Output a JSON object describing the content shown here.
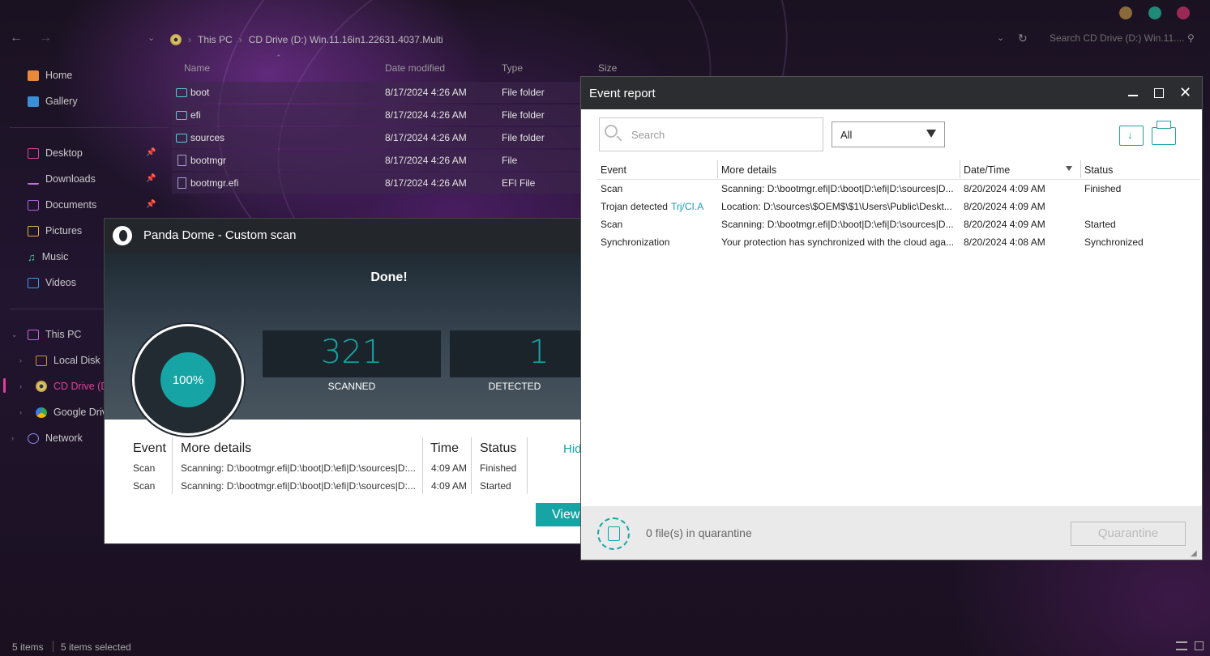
{
  "explorer": {
    "address": [
      "This PC",
      "CD Drive (D:) Win.11.16in1.22631.4037.Multi"
    ],
    "search_placeholder": "Search CD Drive (D:) Win.11....",
    "sidebar": {
      "home": "Home",
      "gallery": "Gallery",
      "desktop": "Desktop",
      "downloads": "Downloads",
      "documents": "Documents",
      "pictures": "Pictures",
      "music": "Music",
      "videos": "Videos",
      "this_pc": "This PC",
      "local_disk": "Local Disk (C:",
      "cd_drive": "CD Drive (D:",
      "google_drive": "Google Drive",
      "network": "Network"
    },
    "columns": [
      "Name",
      "Date modified",
      "Type",
      "Size"
    ],
    "files": [
      {
        "name": "boot",
        "date": "8/17/2024 4:26 AM",
        "type": "File folder"
      },
      {
        "name": "efi",
        "date": "8/17/2024 4:26 AM",
        "type": "File folder"
      },
      {
        "name": "sources",
        "date": "8/17/2024 4:26 AM",
        "type": "File folder"
      },
      {
        "name": "bootmgr",
        "date": "8/17/2024 4:26 AM",
        "type": "File"
      },
      {
        "name": "bootmgr.efi",
        "date": "8/17/2024 4:26 AM",
        "type": "EFI File"
      }
    ],
    "status_items": "5 items",
    "status_selected": "5 items selected"
  },
  "panda": {
    "title": "Panda Dome - Custom scan",
    "done": "Done!",
    "progress": "100%",
    "progress_value": 1.0,
    "scanned_num": "321",
    "scanned_label": "SCANNED",
    "detected_num": "1",
    "detected_label": "DETECTED",
    "headers": [
      "Event",
      "More details",
      "Time",
      "Status"
    ],
    "rows": [
      {
        "event": "Scan",
        "details": "Scanning: D:\\bootmgr.efi|D:\\boot|D:\\efi|D:\\sources|D:...",
        "time": "4:09 AM",
        "status": "Finished"
      },
      {
        "event": "Scan",
        "details": "Scanning: D:\\bootmgr.efi|D:\\boot|D:\\efi|D:\\sources|D:...",
        "time": "4:09 AM",
        "status": "Started"
      }
    ],
    "hide_link": "Hid",
    "view_button": "View"
  },
  "event_report": {
    "title": "Event report",
    "search_placeholder": "Search",
    "filter": "All",
    "headers": [
      "Event",
      "More details",
      "Date/Time",
      "Status"
    ],
    "rows": [
      {
        "event": "Scan",
        "event_link": "",
        "details": "Scanning: D:\\bootmgr.efi|D:\\boot|D:\\efi|D:\\sources|D...",
        "datetime": "8/20/2024 4:09 AM",
        "status": "Finished"
      },
      {
        "event": "Trojan detected",
        "event_link": "Trj/CI.A",
        "details": "Location: D:\\sources\\$OEM$\\$1\\Users\\Public\\Deskt...",
        "datetime": "8/20/2024 4:09 AM",
        "status": ""
      },
      {
        "event": "Scan",
        "event_link": "",
        "details": "Scanning: D:\\bootmgr.efi|D:\\boot|D:\\efi|D:\\sources|D...",
        "datetime": "8/20/2024 4:09 AM",
        "status": "Started"
      },
      {
        "event": "Synchronization",
        "event_link": "",
        "details": "Your protection has synchronized with the cloud aga...",
        "datetime": "8/20/2024 4:08 AM",
        "status": "Synchronized"
      }
    ],
    "quarantine_text": "0 file(s) in quarantine",
    "quarantine_button": "Quarantine"
  },
  "colors": {
    "accent": "#17a4a4",
    "link": "#1a9bb0",
    "pink": "#e0409a"
  }
}
